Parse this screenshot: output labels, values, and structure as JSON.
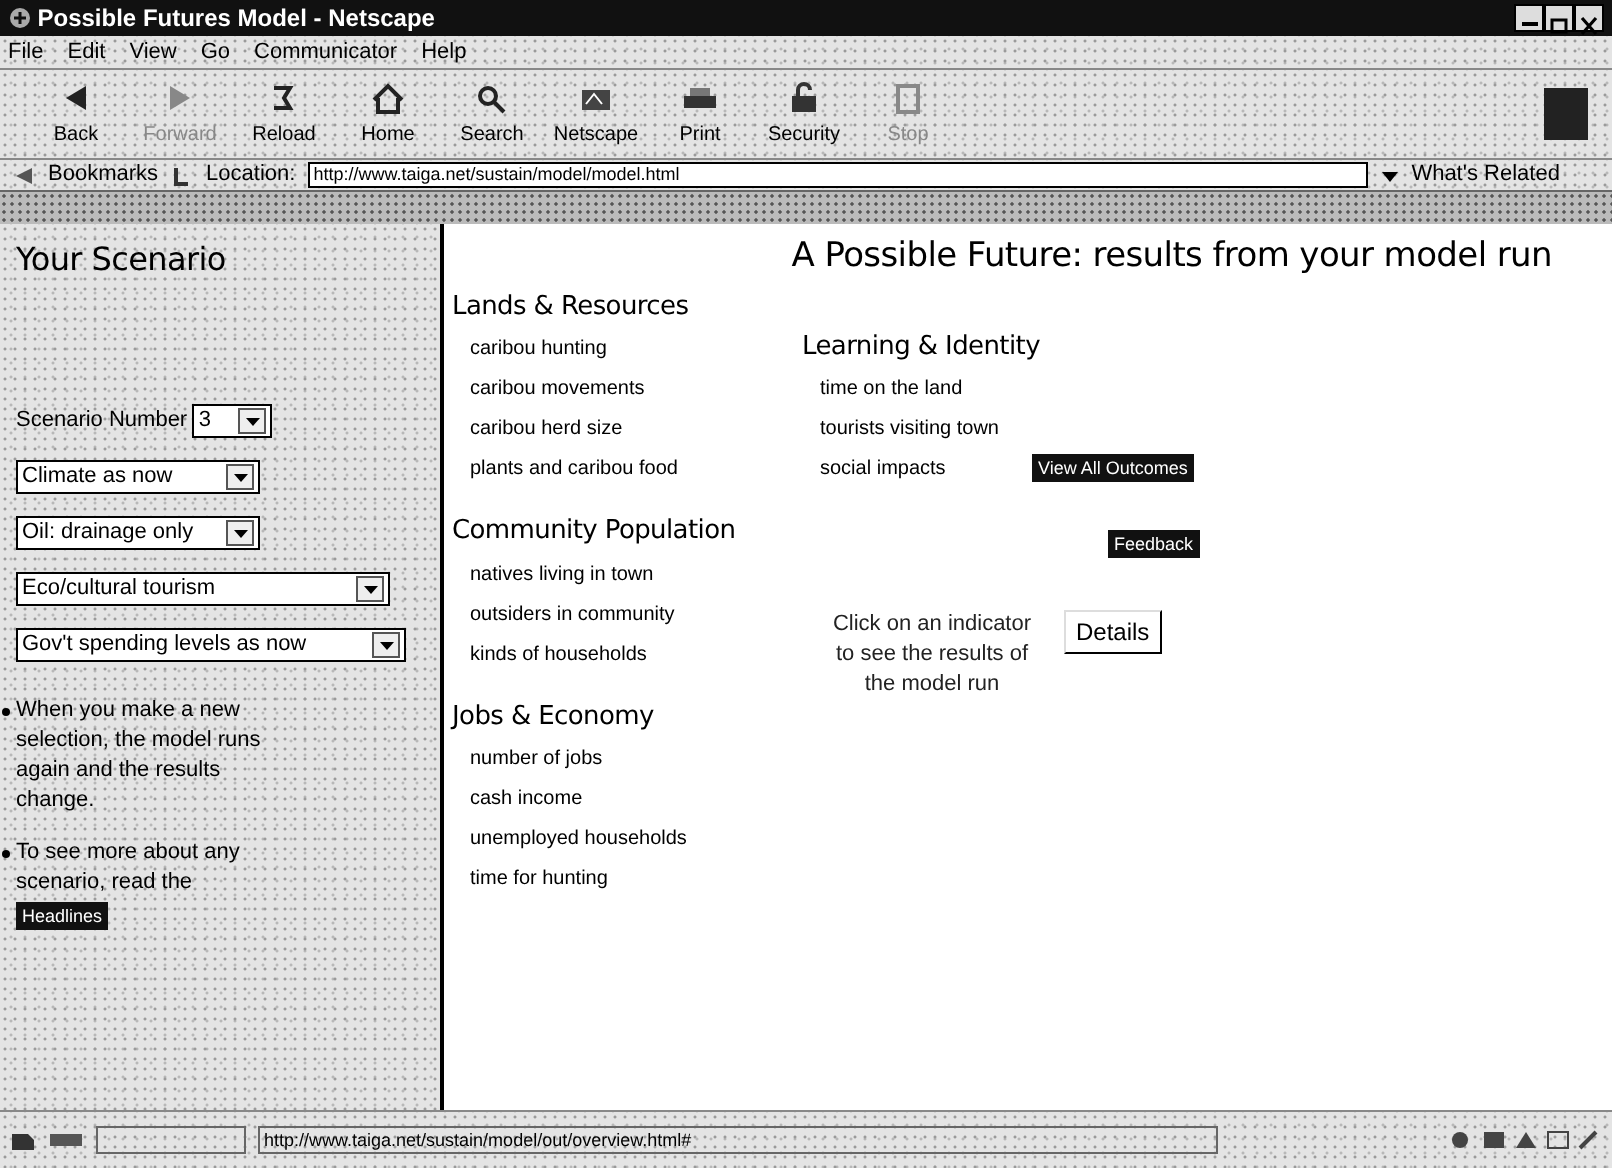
{
  "window": {
    "title": "Possible Futures Model - Netscape"
  },
  "menu": [
    "File",
    "Edit",
    "View",
    "Go",
    "Communicator",
    "Help"
  ],
  "toolbar": [
    {
      "label": "Back",
      "kind": "back",
      "disabled": false
    },
    {
      "label": "Forward",
      "kind": "forward",
      "disabled": true
    },
    {
      "label": "Reload",
      "kind": "reload",
      "disabled": false
    },
    {
      "label": "Home",
      "kind": "home",
      "disabled": false
    },
    {
      "label": "Search",
      "kind": "search",
      "disabled": false
    },
    {
      "label": "Netscape",
      "kind": "netscape",
      "disabled": false
    },
    {
      "label": "Print",
      "kind": "print",
      "disabled": false
    },
    {
      "label": "Security",
      "kind": "security",
      "disabled": false
    },
    {
      "label": "Stop",
      "kind": "stop",
      "disabled": true
    }
  ],
  "location_bar": {
    "bookmarks": "Bookmarks",
    "location_label": "Location:",
    "url": "http://www.taiga.net/sustain/model/model.html",
    "related": "What's Related"
  },
  "sidebar": {
    "heading": "Your Scenario",
    "scenario_label": "Scenario Number",
    "scenario_value": "3",
    "selects": [
      "Climate as now",
      "Oil: drainage only",
      "Eco/cultural tourism",
      "Gov't spending levels as now"
    ],
    "notes": [
      "When you make a new selection, the model runs again and the results change.",
      "To see more about any scenario, read the"
    ],
    "headlines_button": "Headlines"
  },
  "main": {
    "title": "A Possible Future: results from your model run",
    "indicator_columns": [
      [
        {
          "heading": "Lands & Resources",
          "items": [
            "caribou hunting",
            "caribou movements",
            "caribou herd size",
            "plants and caribou food"
          ]
        },
        {
          "heading": "Community Population",
          "items": [
            "natives living in town",
            "outsiders in community",
            "kinds of households"
          ]
        },
        {
          "heading": "Jobs & Economy",
          "items": [
            "number of jobs",
            "cash income",
            "unemployed households",
            "time for hunting"
          ]
        }
      ],
      [
        {
          "heading": "Learning & Identity",
          "items": [
            "time on the land",
            "tourists visiting town",
            "social impacts"
          ]
        }
      ]
    ],
    "view_all_button": "View All Outcomes",
    "feedback_button": "Feedback",
    "hint": "Click on an indicator to see the results of the model run",
    "details_button": "Details"
  },
  "status_bar": {
    "url": "http://www.taiga.net/sustain/model/out/overview.html#"
  }
}
